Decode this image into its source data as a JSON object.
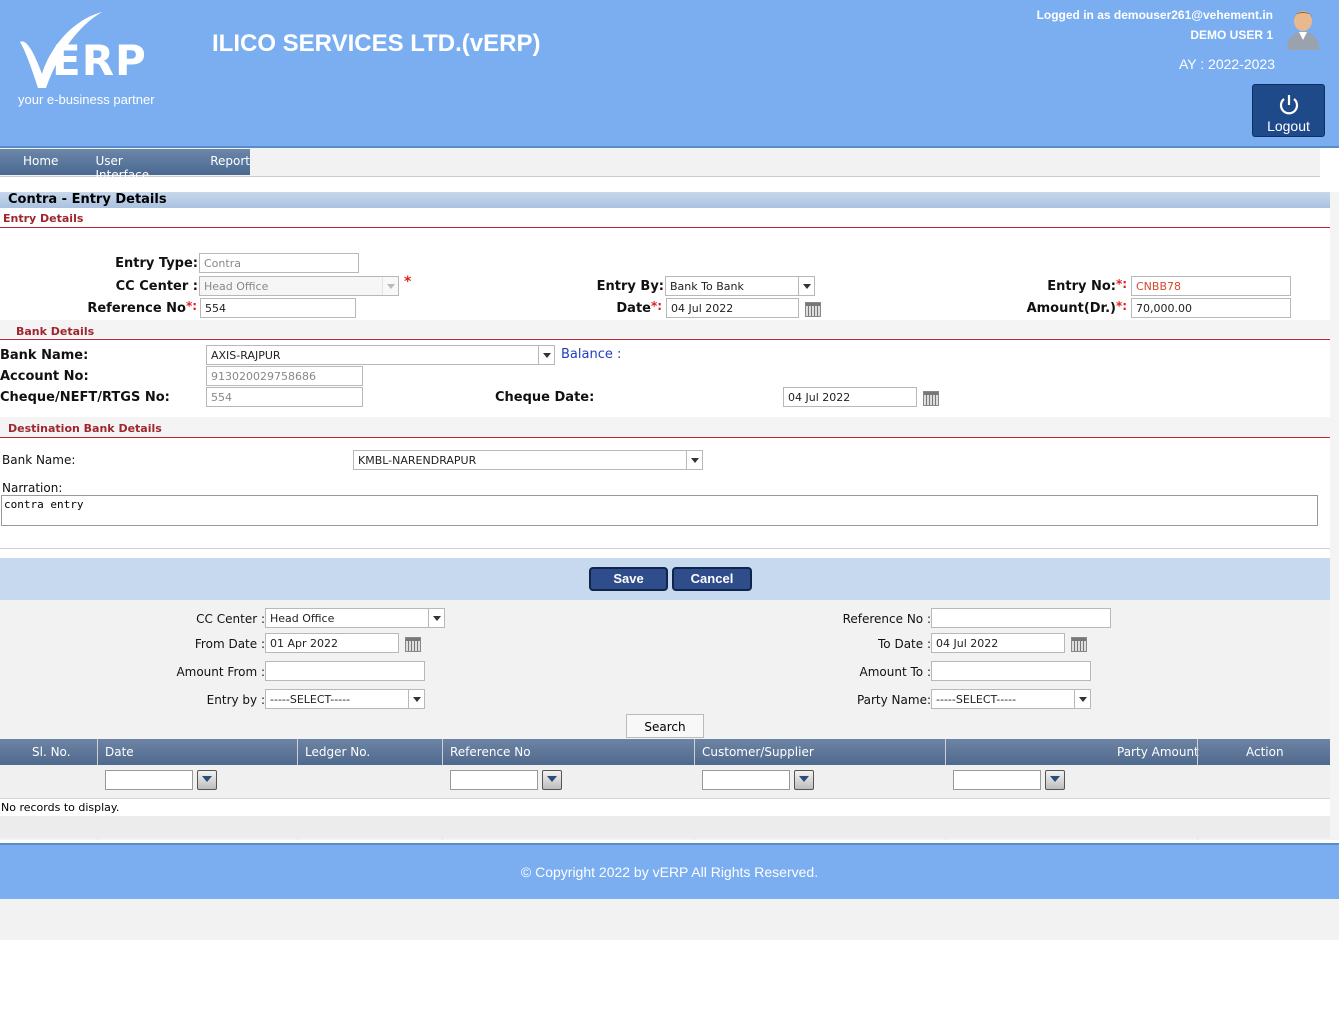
{
  "header": {
    "logo_letters": "ERP",
    "logo_tagline": "your e-business partner",
    "company": "ILICO SERVICES LTD.(vERP)",
    "logged_in": "Logged in as demouser261@vehement.in",
    "user_name": "DEMO USER 1",
    "academic_year": "AY : 2022-2023",
    "logout_label": "Logout"
  },
  "menu": {
    "items": [
      "Home",
      "User Interface",
      "Report"
    ]
  },
  "page_title": "Contra - Entry Details",
  "entry": {
    "section_label": "Entry Details",
    "entry_type_label": "Entry Type:",
    "entry_type_value": "Contra",
    "cc_center_label": "CC Center :",
    "cc_center_value": "Head Office",
    "reference_label": "Reference No",
    "reference_value": "554",
    "entry_by_label": "Entry By:",
    "entry_by_value": "Bank To Bank",
    "date_label": "Date",
    "date_value": "04 Jul 2022",
    "entry_no_label": "Entry No:",
    "entry_no_value": "CNBB78",
    "amount_label": "Amount(Dr.)",
    "amount_value": "70,000.00"
  },
  "bank": {
    "section_label": "Bank Details",
    "bank_name_label": "Bank Name:",
    "bank_name_value": "AXIS-RAJPUR",
    "balance_label": "Balance :",
    "account_label": "Account No:",
    "account_value": "913020029758686",
    "cheque_label": "Cheque/NEFT/RTGS No:",
    "cheque_value": "554",
    "cheque_date_label": "Cheque Date:",
    "cheque_date_value": "04 Jul 2022"
  },
  "dest": {
    "section_label": "Destination Bank Details",
    "bank_name_label": "Bank Name:",
    "bank_name_value": "KMBL-NARENDRAPUR",
    "narration_label": "Narration:",
    "narration_value": "contra entry"
  },
  "actions": {
    "save": "Save",
    "cancel": "Cancel"
  },
  "search": {
    "cc_center_label": "CC Center :",
    "cc_center_value": "Head Office",
    "from_date_label": "From Date :",
    "from_date_value": "01 Apr 2022",
    "amount_from_label": "Amount From :",
    "entry_by_label": "Entry by :",
    "entry_by_value": "-----SELECT-----",
    "reference_label": "Reference No :",
    "to_date_label": "To Date :",
    "to_date_value": "04 Jul 2022",
    "amount_to_label": "Amount To :",
    "party_label": "Party Name:",
    "party_value": "-----SELECT-----",
    "search_button": "Search"
  },
  "grid": {
    "columns": [
      "Sl. No.",
      "Date",
      "Ledger No.",
      "Reference No",
      "Customer/Supplier",
      "Party Amount",
      "Action"
    ],
    "empty_message": "No records to display."
  },
  "footer": {
    "copyright": "© Copyright 2022 by vERP All Rights Reserved."
  },
  "colors": {
    "header_bg": "#7aaef0",
    "accent_red": "#c0252d",
    "button_dark": "#2e4d8a"
  }
}
